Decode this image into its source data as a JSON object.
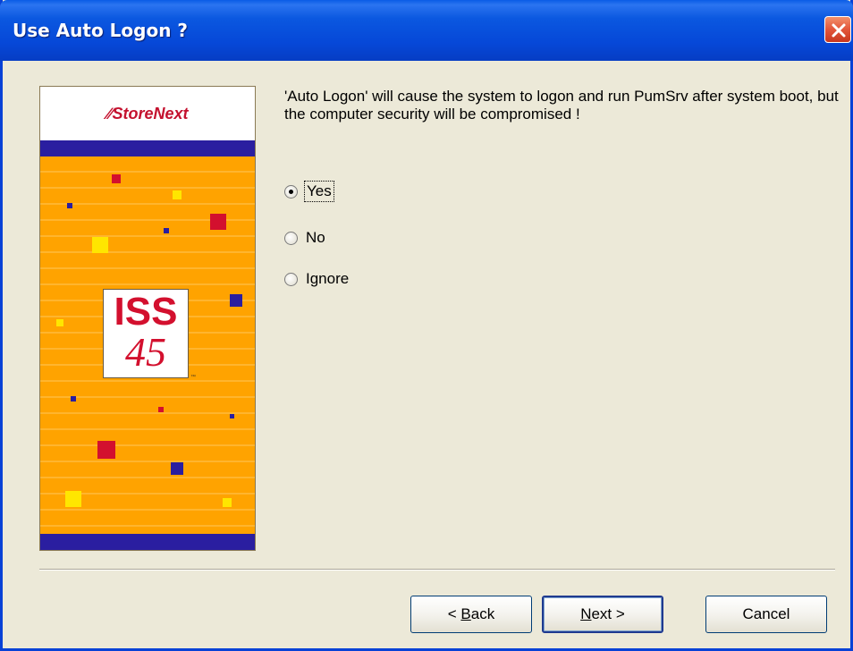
{
  "window": {
    "title": "Use Auto Logon ?",
    "close_icon": "close-icon"
  },
  "banner": {
    "brand": "StoreNext",
    "logo_top": "ISS",
    "logo_bottom": "45",
    "trademark": "™"
  },
  "message": "'Auto Logon' will cause the system to logon and run PumSrv after system boot, but the computer security will be compromised !",
  "options": [
    {
      "label": "Yes",
      "checked": true
    },
    {
      "label": "No",
      "checked": false
    },
    {
      "label": "Ignore",
      "checked": false
    }
  ],
  "buttons": {
    "back": {
      "prefix": "< ",
      "mnemonic": "B",
      "rest": "ack"
    },
    "next": {
      "mnemonic": "N",
      "rest": "ext >"
    },
    "cancel": "Cancel"
  },
  "colors": {
    "titlebar": "#0648d8",
    "banner_orange": "#ffa300",
    "banner_band": "#2a1ea0",
    "logo_red": "#d3102e",
    "dialog_bg": "#ece9d8"
  }
}
